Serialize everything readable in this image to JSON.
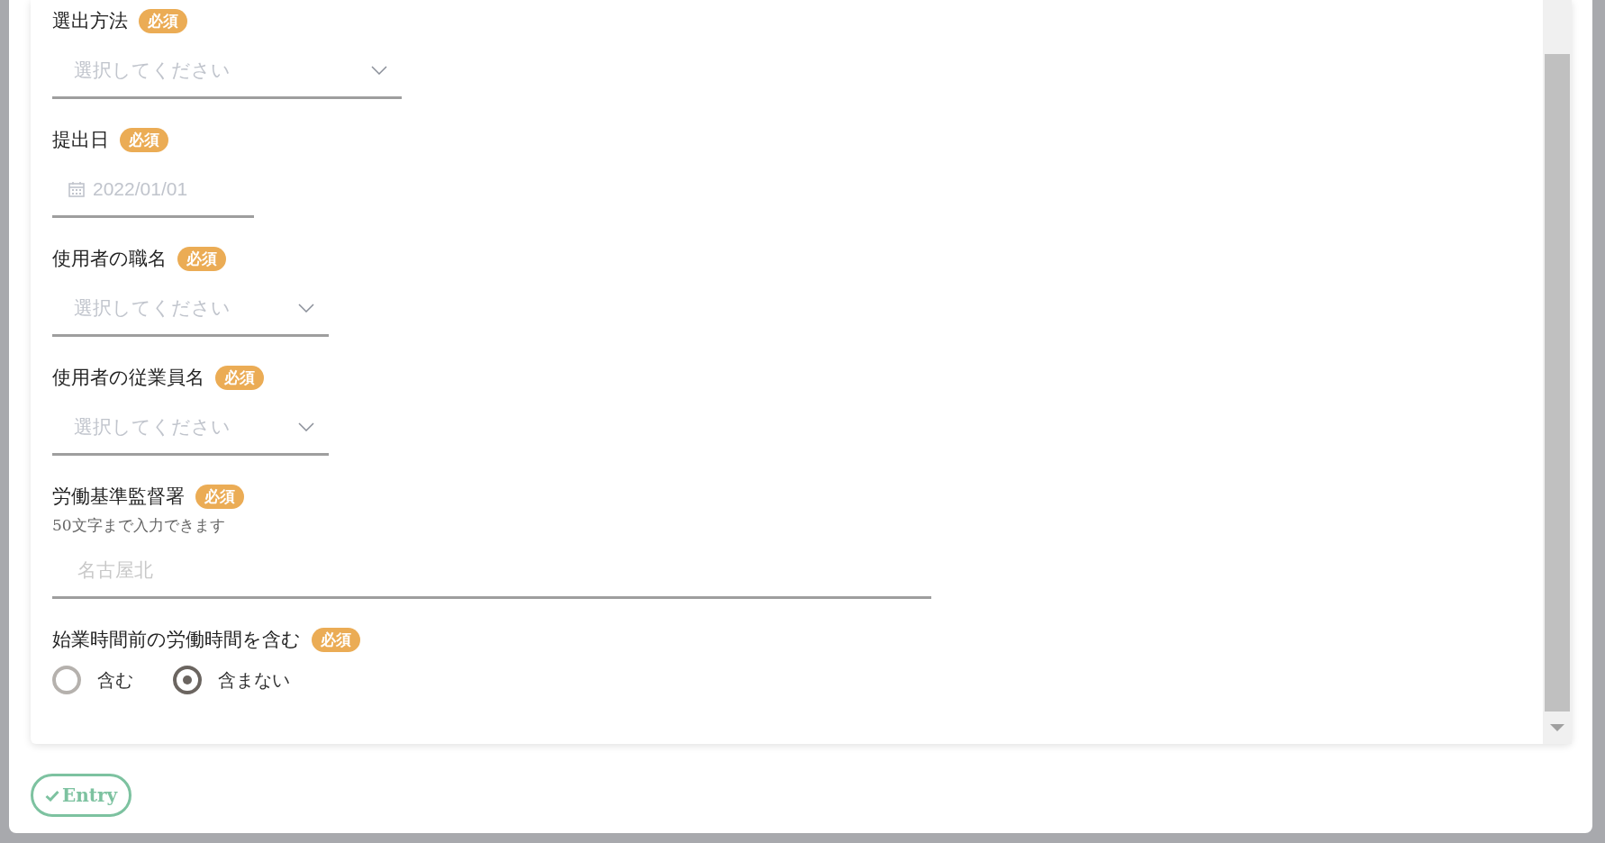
{
  "fields": [
    {
      "kind": "select",
      "label": "選出方法",
      "badge": "必須",
      "placeholder": "選択してください"
    },
    {
      "kind": "date",
      "label": "提出日",
      "badge": "必須",
      "placeholder": "2022/01/01"
    },
    {
      "kind": "select",
      "label": "使用者の職名",
      "badge": "必須",
      "placeholder": "選択してください"
    },
    {
      "kind": "select",
      "label": "使用者の従業員名",
      "badge": "必須",
      "placeholder": "選択してください"
    },
    {
      "kind": "text",
      "label": "労働基準監督署",
      "badge": "必須",
      "hint": "50文字まで入力できます",
      "placeholder": "名古屋北"
    },
    {
      "kind": "radio",
      "label": "始業時間前の労働時間を含む",
      "badge": "必須",
      "options": [
        {
          "label": "含む",
          "selected": false
        },
        {
          "label": "含まない",
          "selected": true
        }
      ]
    }
  ],
  "entry_button": "Entry"
}
